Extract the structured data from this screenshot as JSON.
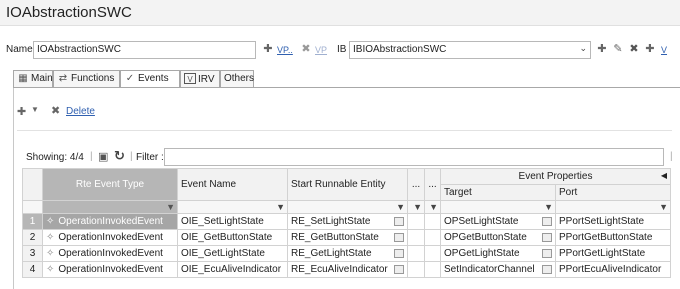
{
  "window": {
    "title": "IOAbstractionSWC"
  },
  "name_row": {
    "name_label": "Name",
    "name_value": "IOAbstractionSWC",
    "vp_link": "VP..",
    "vp_disabled": "VP",
    "ib_label": "IB",
    "ib_value": "IBIOAbstractionSWC",
    "v_link": "V"
  },
  "tabs": [
    {
      "label": "Main",
      "icon": "main-icon"
    },
    {
      "label": "Functions",
      "icon": "functions-icon"
    },
    {
      "label": "Events",
      "icon": "events-icon",
      "active": true
    },
    {
      "label": "IRV",
      "icon": "irv-icon"
    },
    {
      "label": "Others"
    }
  ],
  "toolbar": {
    "delete_label": "Delete"
  },
  "filter_row": {
    "showing": "Showing: 4/4",
    "filter_label": "Filter :",
    "filter_value": ""
  },
  "grid": {
    "headers": {
      "rte_event_type": "Rte Event Type",
      "event_name": "Event Name",
      "start_runnable": "Start Runnable Entity",
      "dots1": "...",
      "dots2": "...",
      "event_properties": "Event Properties",
      "target": "Target",
      "port": "Port"
    },
    "rows": [
      {
        "num": "1",
        "type": "OperationInvokedEvent",
        "name": "OIE_SetLightState",
        "runnable": "RE_SetLightState",
        "target": "OPSetLightState",
        "port": "PPortSetLightState"
      },
      {
        "num": "2",
        "type": "OperationInvokedEvent",
        "name": "OIE_GetButtonState",
        "runnable": "RE_GetButtonState",
        "target": "OPGetButtonState",
        "port": "PPortGetButtonState"
      },
      {
        "num": "3",
        "type": "OperationInvokedEvent",
        "name": "OIE_GetLightState",
        "runnable": "RE_GetLightState",
        "target": "OPGetLightState",
        "port": "PPortGetLightState"
      },
      {
        "num": "4",
        "type": "OperationInvokedEvent",
        "name": "OIE_EcuAliveIndicator",
        "runnable": "RE_EcuAliveIndicator",
        "target": "SetIndicatorChannel",
        "port": "PPortEcuAliveIndicator"
      }
    ]
  }
}
